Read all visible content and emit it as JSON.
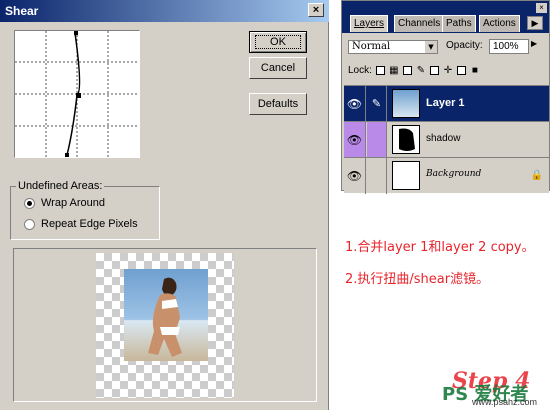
{
  "dialog": {
    "title": "Shear",
    "close_glyph": "×",
    "ok_label": "OK",
    "cancel_label": "Cancel",
    "defaults_label": "Defaults",
    "undefined_areas_label": "Undefined Areas:",
    "options": [
      {
        "label": "Wrap Around",
        "selected": true
      },
      {
        "label": "Repeat Edge Pixels",
        "selected": false
      }
    ]
  },
  "palette": {
    "tabs": [
      "Layers",
      "Channels",
      "Paths",
      "Actions"
    ],
    "close_glyph": "×",
    "menu_glyph": "▶",
    "blend_mode": "Normal",
    "opacity_label": "Opacity:",
    "opacity_value": "100%",
    "lock_label": "Lock:",
    "layers": [
      {
        "name": "Layer 1",
        "selected": true
      },
      {
        "name": "shadow",
        "selected": false
      },
      {
        "name": "Background",
        "selected": false
      }
    ]
  },
  "notes": [
    "1.合并layer 1和layer 2 copy。",
    "2.执行扭曲/shear滤镜。"
  ],
  "step_text": "Step 4",
  "watermark": {
    "text": "PS 爱好者",
    "url": "www.psahz.com"
  },
  "colors": {
    "accent": "#0a246a",
    "note": "#e8242b",
    "dialog_bg": "#d4d0c8"
  }
}
